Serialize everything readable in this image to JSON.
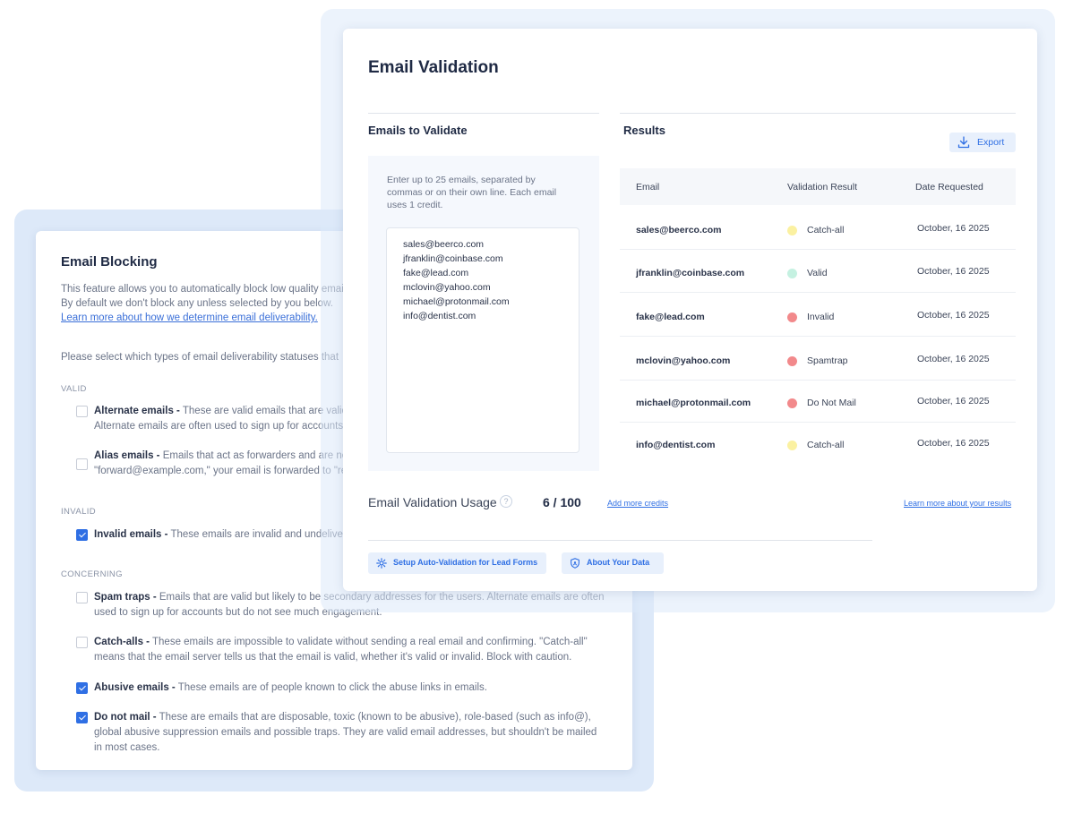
{
  "colors": {
    "accent": "#2f6fe4",
    "status_yellow": "#fbf1a1",
    "status_green": "#c5f1e1",
    "status_red": "#f2898b"
  },
  "email_blocking": {
    "title": "Email Blocking",
    "description_lines": [
      "This feature allows you to automatically block low quality emails",
      "By default we don't block any unless selected by you below."
    ],
    "learn_more_link": "Learn more about how we determine email deliverability.",
    "prompt": "Please select which types of email deliverability statuses that",
    "sections": {
      "valid": "VALID",
      "invalid": "INVALID",
      "concerning": "CONCERNING"
    },
    "options": [
      {
        "name": "Alternate emails -",
        "lines": [
          "These are valid emails that are valid",
          "Alternate emails are often used to sign up for accounts"
        ],
        "checked": false
      },
      {
        "name": "Alias emails -",
        "lines": [
          "Emails that act as forwarders and are not",
          "\"forward@example.com,\" your email is forwarded to \"re"
        ],
        "checked": false
      },
      {
        "name": "Invalid emails -",
        "lines": [
          "These emails are invalid and undeliverable."
        ],
        "checked": true
      },
      {
        "name": "Spam traps -",
        "lines": [
          "Emails that are valid but likely to be secondary addresses for the users. Alternate emails are often",
          "used to sign up for accounts but do not see much engagement."
        ],
        "checked": false
      },
      {
        "name": "Catch-alls -",
        "lines": [
          "These emails are impossible to validate without sending a real email and confirming. \"Catch-all\"",
          "means that the email server tells us that the email is valid, whether it's valid or invalid. Block with caution."
        ],
        "checked": false
      },
      {
        "name": "Abusive emails -",
        "lines": [
          "These emails are of people known to click the abuse links in emails."
        ],
        "checked": true
      },
      {
        "name": "Do not mail -",
        "lines": [
          "These are emails that are disposable, toxic (known to be abusive), role-based (such as info@),",
          "global abusive suppression emails and possible traps. They are valid email addresses, but shouldn't be mailed",
          "in most cases."
        ],
        "checked": true
      }
    ]
  },
  "validation": {
    "title": "Email Validation",
    "left_title": "Emails to Validate",
    "help_lines": [
      "Enter up to 25 emails, separated by",
      "commas or on their own line. Each email",
      "uses 1 credit."
    ],
    "input_emails": [
      "sales@beerco.com",
      "jfranklin@coinbase.com",
      "fake@lead.com",
      "mclovin@yahoo.com",
      "michael@protonmail.com",
      "info@dentist.com"
    ],
    "results_title": "Results",
    "export_label": "Export",
    "columns": [
      "Email",
      "Validation Result",
      "Date Requested"
    ],
    "rows": [
      {
        "email": "sales@beerco.com",
        "result": "Catch-all",
        "status": "yellow",
        "date": "October, 16 2025"
      },
      {
        "email": "jfranklin@coinbase.com",
        "result": "Valid",
        "status": "green",
        "date": "October, 16 2025"
      },
      {
        "email": "fake@lead.com",
        "result": "Invalid",
        "status": "red",
        "date": "October, 16 2025"
      },
      {
        "email": "mclovin@yahoo.com",
        "result": "Spamtrap",
        "status": "red",
        "date": "October, 16 2025"
      },
      {
        "email": "michael@protonmail.com",
        "result": "Do Not Mail",
        "status": "red",
        "date": "October, 16 2025"
      },
      {
        "email": "info@dentist.com",
        "result": "Catch-all",
        "status": "yellow",
        "date": "October, 16 2025"
      }
    ],
    "usage": {
      "label": "Email Validation Usage",
      "help_glyph": "?",
      "used": 6,
      "total": 100,
      "display": "6 / 100",
      "add_credits": "Add more credits",
      "learn_more": "Learn more about your results"
    },
    "buttons": {
      "auto_validation": "Setup Auto-Validation for Lead Forms",
      "about_data": "About Your Data"
    }
  }
}
